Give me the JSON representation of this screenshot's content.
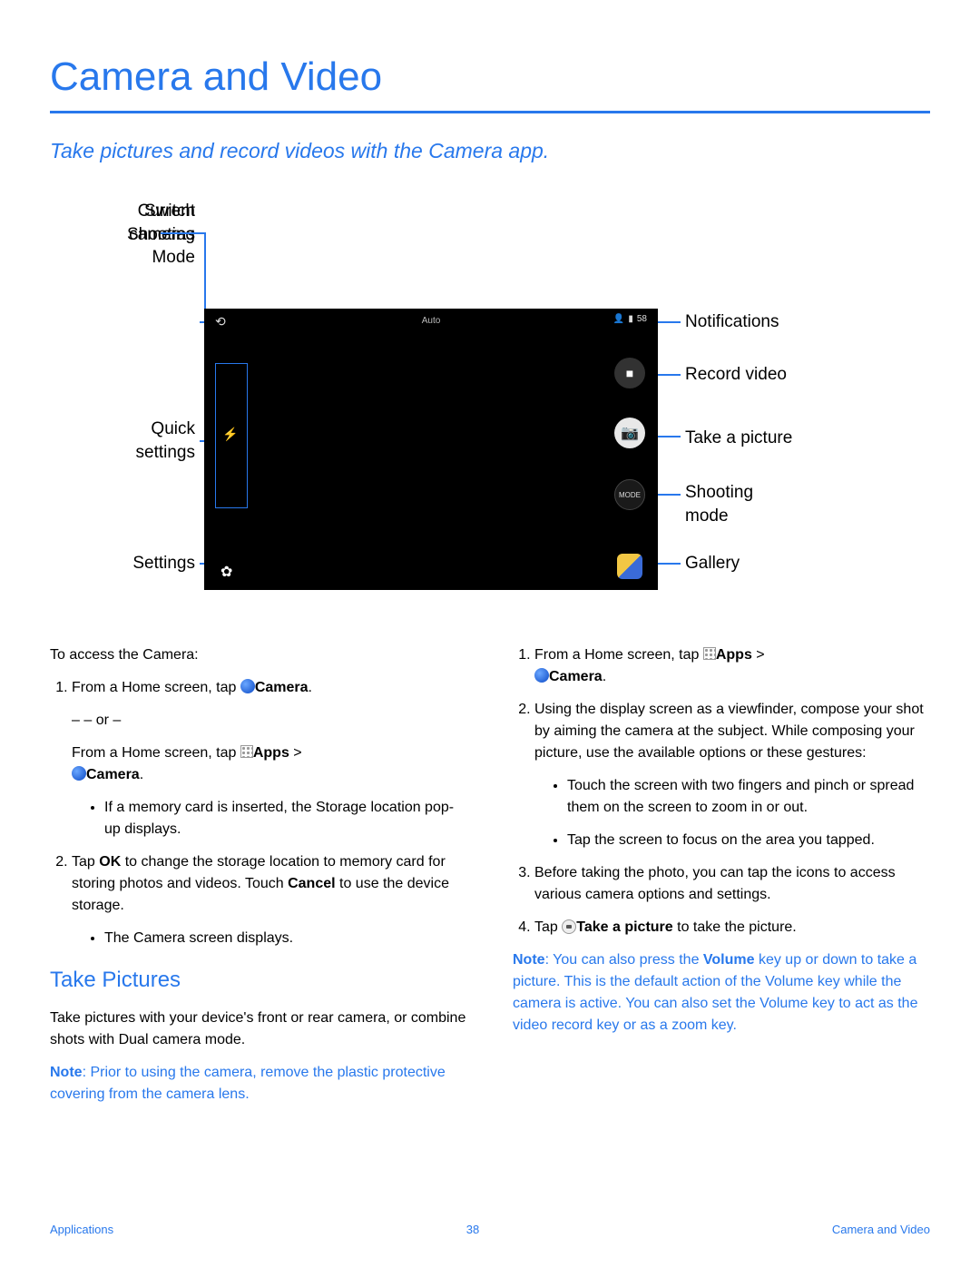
{
  "header": {
    "title": "Camera and Video",
    "subtitle": "Take pictures and record videos with the Camera app."
  },
  "diagram": {
    "left_labels": {
      "mode": "Current\nShooting\nMode",
      "switch": "Switch\ncameras",
      "quick": "Quick\nsettings",
      "settings": "Settings"
    },
    "right_labels": {
      "notif": "Notifications",
      "record": "Record video",
      "shutter": "Take a picture",
      "mode": "Shooting\nmode",
      "gallery": "Gallery"
    },
    "phone": {
      "auto": "Auto",
      "count": "58",
      "mode_btn": "MODE"
    }
  },
  "left_col": {
    "intro": "To access the Camera:",
    "step1_a": "From a Home screen, tap ",
    "step1_b": "Camera",
    "or": "– or –",
    "alt_a": "From a Home screen, tap ",
    "alt_b": "Apps",
    "alt_c": " > ",
    "alt_d": "Camera",
    "bullet1": "If a memory card is inserted, the Storage location pop-up displays.",
    "step2_a": "Tap ",
    "step2_b": "OK",
    "step2_c": " to change the storage location to memory card for storing photos and videos. Touch ",
    "step2_d": "Cancel",
    "step2_e": " to use the device storage.",
    "bullet2": "The Camera screen displays.",
    "section": "Take Pictures",
    "sec_p": "Take pictures with your device's front or rear camera, or combine shots with Dual camera mode.",
    "note_label": "Note",
    "note_body": ": Prior to using the camera, remove the plastic protective covering from the camera lens."
  },
  "right_col": {
    "s1_a": "From a Home screen, tap ",
    "s1_b": "Apps",
    "s1_c": " > ",
    "s1_d": "Camera",
    "s1_e": ".",
    "s2": "Using the display screen as a viewfinder, compose your shot by aiming the camera at the subject. While composing your picture, use the available options or these gestures:",
    "s2b1": "Touch the screen with two fingers and pinch or spread them on the screen to zoom in or out.",
    "s2b2": "Tap the screen to focus on the area you tapped.",
    "s3": "Before taking the photo, you can tap the icons to access various camera options and settings.",
    "s4_a": "Tap ",
    "s4_b": "Take a picture",
    "s4_c": " to take the picture.",
    "note_label": "Note",
    "note_body": ": You can also press the ",
    "note_vol": "Volume",
    "note_body2": " key up or down to take a picture. This is the default action of the Volume key while the camera is active. You can also set the Volume key to act as the video record key or as a zoom key."
  },
  "footer": {
    "left": "Applications",
    "center": "38",
    "right": "Camera and Video"
  }
}
